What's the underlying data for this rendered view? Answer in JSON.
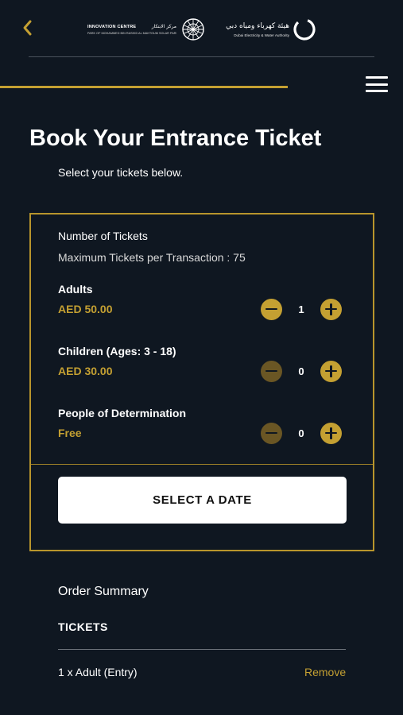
{
  "header": {
    "back_icon": "chevron-left-icon",
    "innovation_logo": {
      "name_en": "INNOVATION CENTRE",
      "name_ar": "مركز الابتكار",
      "subline": "PARK OF MOHAMMED BIN RASHID AL MAKTOUM SOLAR PARK"
    },
    "dewa_logo": {
      "name_ar": "هيئة كهرباء ومياه دبي",
      "name_en": "Dubai Electricity & Water Authority"
    },
    "menu_icon": "hamburger-menu-icon"
  },
  "page": {
    "title": "Book Your Entrance Ticket",
    "subtitle": "Select your tickets below."
  },
  "tickets": {
    "heading": "Number of Tickets",
    "max_note": "Maximum Tickets per Transaction : 75",
    "rows": [
      {
        "label": "Adults",
        "price": "AED 50.00",
        "quantity": "1",
        "minus_enabled": true
      },
      {
        "label": "Children (Ages: 3 - 18)",
        "price": "AED 30.00",
        "quantity": "0",
        "minus_enabled": false
      },
      {
        "label": "People of Determination",
        "price": "Free",
        "quantity": "0",
        "minus_enabled": false
      }
    ],
    "select_date_label": "SELECT A DATE"
  },
  "summary": {
    "title": "Order Summary",
    "section_label": "TICKETS",
    "items": [
      {
        "text": "1 x Adult (Entry)",
        "action": "Remove"
      }
    ]
  },
  "colors": {
    "background": "#0f1721",
    "accent_gold": "#c4a032",
    "accent_gold_dim": "#6a5624",
    "border_gold": "#b8952c",
    "button_white": "#ffffff"
  }
}
